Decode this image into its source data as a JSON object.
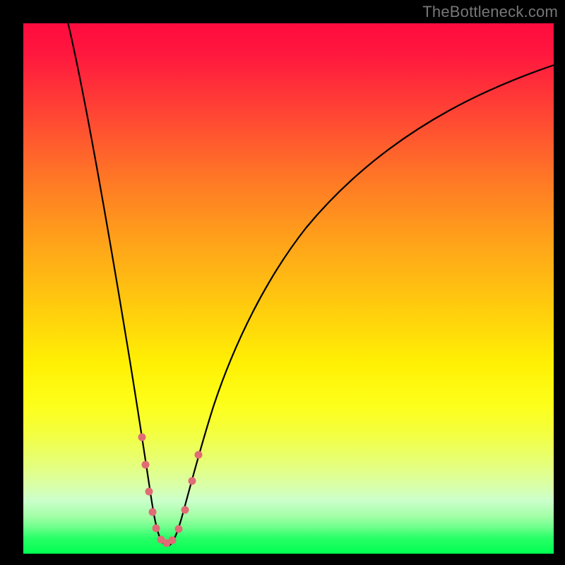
{
  "watermark": "TheBottleneck.com",
  "colors": {
    "frame": "#000000",
    "curve": "#000000",
    "marker": "#e06c76",
    "gradient_top": "#ff0b3e",
    "gradient_bottom": "#00ff50"
  },
  "chart_data": {
    "type": "line",
    "title": "",
    "xlabel": "",
    "ylabel": "",
    "xlim": [
      0,
      100
    ],
    "ylim": [
      0,
      100
    ],
    "x": [
      0,
      2,
      5,
      8,
      11,
      14,
      17,
      19,
      20.5,
      22,
      23,
      24,
      25,
      26,
      27,
      28,
      29,
      30.5,
      32,
      34,
      37,
      41,
      46,
      52,
      59,
      67,
      76,
      86,
      97,
      100
    ],
    "values": [
      104,
      98,
      90,
      81,
      71,
      60,
      47,
      36,
      26,
      17,
      11,
      6,
      3,
      1.5,
      1.5,
      2.5,
      5,
      10,
      17,
      26,
      38,
      51,
      62,
      71,
      78,
      84,
      89,
      93,
      97,
      98
    ],
    "markers": {
      "x": [
        20.5,
        22.2,
        23.5,
        24.8,
        25.5,
        26.5,
        27.2,
        28.8,
        30.2
      ],
      "y": [
        26,
        16,
        9,
        4,
        2,
        2,
        3,
        7,
        14
      ]
    },
    "annotations": []
  }
}
